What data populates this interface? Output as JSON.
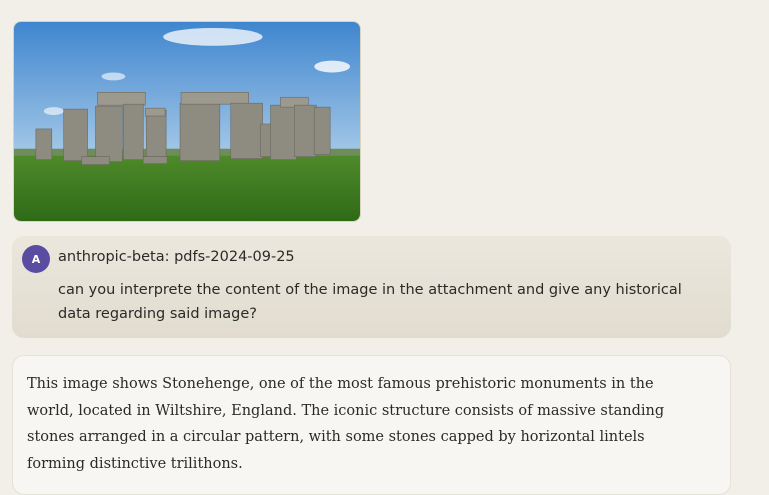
{
  "attachment": {
    "alt": "Stonehenge photo"
  },
  "user_message": {
    "avatar_initial": "A",
    "name": "anthropic-beta: pdfs-2024-09-25",
    "text": "can you interprete the content of the image in the attachment and give any historical data regarding said image?"
  },
  "assistant_message": {
    "text": "This image shows Stonehenge, one of the most famous prehistoric monuments in the world, located in Wiltshire, England. The iconic structure consists of massive standing stones arranged in a circular pattern, with some stones capped by horizontal lintels forming distinctive trilithons."
  },
  "colors": {
    "background": "#f2efe8",
    "avatar": "#5a4ca0",
    "user_bubble": "#e6e1d6"
  }
}
